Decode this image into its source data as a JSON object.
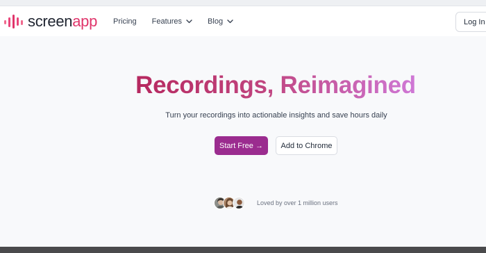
{
  "brand": {
    "name_part1": "screen",
    "name_part2": "app",
    "accent_color": "#e0356b"
  },
  "nav": {
    "items": [
      {
        "label": "Pricing",
        "has_dropdown": false
      },
      {
        "label": "Features",
        "has_dropdown": true
      },
      {
        "label": "Blog",
        "has_dropdown": true
      }
    ],
    "login_label": "Log In"
  },
  "hero": {
    "title": "Recordings, Reimagined",
    "subtitle": "Turn your recordings into actionable insights and save hours daily",
    "primary_cta": "Start Free →",
    "secondary_cta": "Add to Chrome",
    "primary_color": "#9b2c8f",
    "title_gradient": [
      "#b6285f",
      "#cf78d6"
    ]
  },
  "social_proof": {
    "text": "Loved by over 1 million users",
    "avatars": [
      "avatar-1",
      "avatar-2",
      "avatar-3"
    ]
  }
}
